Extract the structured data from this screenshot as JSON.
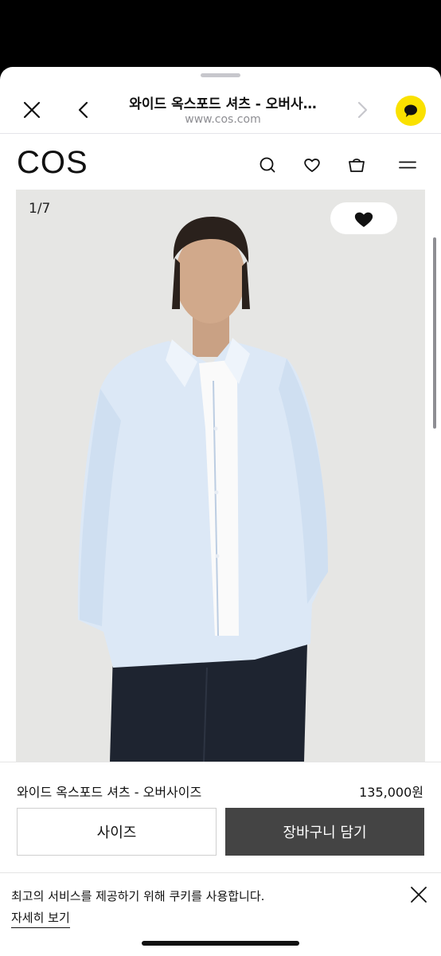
{
  "browser": {
    "title": "와이드 옥스포드 셔츠 - 오버사…",
    "url": "www.cos.com"
  },
  "site": {
    "logo": "COS"
  },
  "gallery": {
    "counter": "1/7"
  },
  "product": {
    "name": "와이드 옥스포드 셔츠 - 오버사이즈",
    "price": "135,000원",
    "size_label": "사이즈",
    "cart_label": "장바구니 담기"
  },
  "cookie": {
    "message": "최고의 서비스를 제공하기 위해 쿠키를 사용합니다.",
    "link": "자세히 보기"
  },
  "colors": {
    "kakao": "#fae100",
    "cart_button": "#444444"
  }
}
